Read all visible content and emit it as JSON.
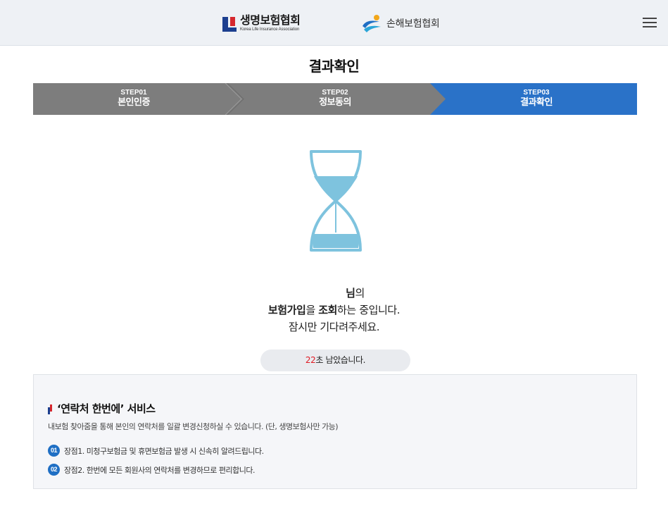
{
  "header": {
    "logo_life_ko": "생명보험협회",
    "logo_life_en": "Korea Life Insurance Association",
    "logo_nonlife": "손해보험협회",
    "menu_icon": "hamburger-menu-icon"
  },
  "page_title": "결과확인",
  "steps": [
    {
      "num": "STEP01",
      "label": "본인인증",
      "active": false
    },
    {
      "num": "STEP02",
      "label": "정보동의",
      "active": false
    },
    {
      "num": "STEP03",
      "label": "결과확인",
      "active": true
    }
  ],
  "colors": {
    "step_inactive": "#7d7d7d",
    "step_active": "#2a72c8",
    "timer_seconds": "#e01b24",
    "hourglass": "#7ec3de",
    "badge": "#1f6fc4"
  },
  "message": {
    "name_suffix_bold": "님",
    "name_suffix_rest": "의",
    "line2_bold1": "보험가입",
    "line2_mid": "을 ",
    "line2_bold2": "조회",
    "line2_rest": "하는 중입니다.",
    "line3": "잠시만 기다려주세요."
  },
  "timer": {
    "seconds": "22",
    "suffix": "초 남았습니다."
  },
  "service": {
    "title": "‘연락처 한번에’ 서비스",
    "description": "내보험 찾아줌을 통해 본인의 연락처를 일괄 변경신청하실 수 있습니다. (단, 생명보험사만 가능)",
    "items": [
      {
        "num": "01",
        "text": "장점1. 미청구보험금 및 휴면보험금 발생 시 신속히 알려드립니다."
      },
      {
        "num": "02",
        "text": "장점2. 한번에 모든 회원사의 연락처를 변경하므로 편리합니다."
      }
    ]
  }
}
